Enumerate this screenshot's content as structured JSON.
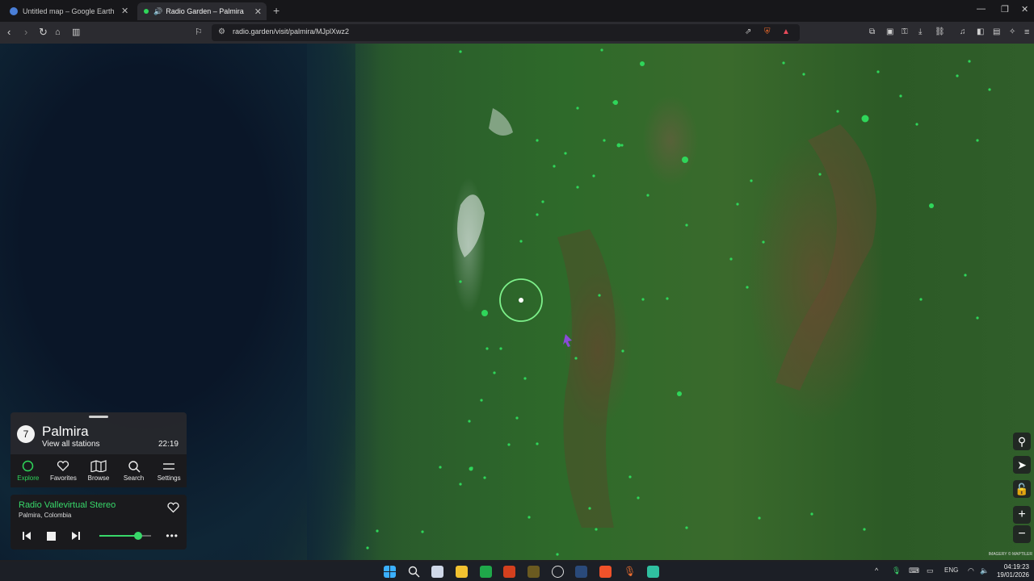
{
  "browser": {
    "tabs": [
      {
        "title": "Untitled map – Google Earth",
        "active": false
      },
      {
        "title": "Radio Garden – Palmira",
        "active": true
      }
    ],
    "url": "radio.garden/visit/palmira/MJplXwz2"
  },
  "panel": {
    "station_count": "7",
    "city": "Palmira",
    "view_all": "View all stations",
    "local_time": "22:19",
    "nav": [
      {
        "label": "Explore",
        "icon": "explore-icon"
      },
      {
        "label": "Favorites",
        "icon": "heart-icon"
      },
      {
        "label": "Browse",
        "icon": "map-icon"
      },
      {
        "label": "Search",
        "icon": "search-icon"
      },
      {
        "label": "Settings",
        "icon": "menu-icon"
      }
    ]
  },
  "player": {
    "station": "Radio Vallevirtual Stereo",
    "place": "Palmira, Colombia",
    "volume": 0.75
  },
  "map": {
    "credit": "IMAGERY © MAPTILER",
    "accent": "#2fd65a"
  },
  "taskbar": {
    "language": "ENG",
    "time": "04:19:23",
    "date": "19/01/2026"
  }
}
